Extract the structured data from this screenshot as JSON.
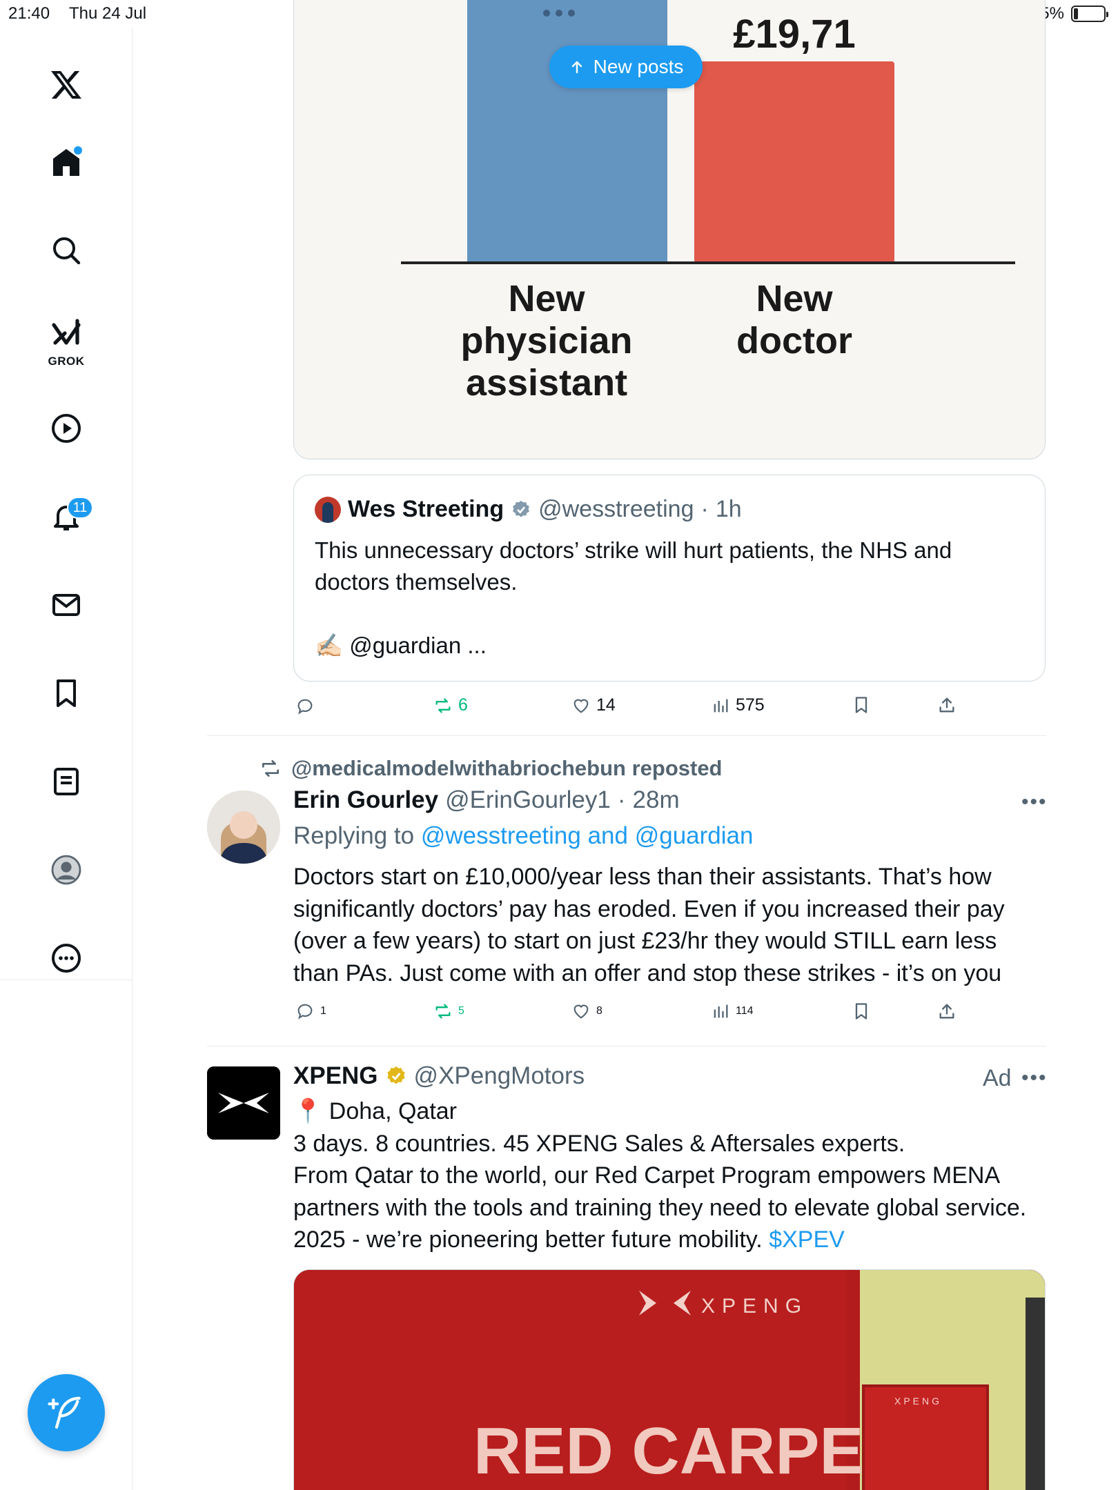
{
  "status_bar": {
    "time": "21:40",
    "date": "Thu 24 Jul",
    "battery": "15%"
  },
  "sidebar": {
    "grok_label": "GROK",
    "notifications_badge": "11"
  },
  "new_posts_label": "New posts",
  "chart_data": {
    "type": "bar",
    "categories": [
      "New physician assistant",
      "New doctor"
    ],
    "category_lines": [
      [
        "New",
        "physician",
        "assistant"
      ],
      [
        "New",
        "doctor"
      ]
    ],
    "visible_value_labels": [
      "",
      "£19,71"
    ],
    "colors": [
      "#6494c0",
      "#e0594a"
    ],
    "note_cropped": true
  },
  "quoted_post": {
    "name": "Wes Streeting",
    "handle": "@wesstreeting",
    "time": "1h",
    "text_line1": "This unnecessary doctors’ strike will hurt patients, the NHS and",
    "text_line2": "doctors themselves.",
    "text_line3": "✍🏻 @guardian ..."
  },
  "post1_actions": {
    "replies": "",
    "reposts": "6",
    "likes": "14",
    "views": "575"
  },
  "repost_banner": "@medicalmodelwithabriochebun reposted",
  "post2": {
    "name": "Erin Gourley",
    "handle": "@ErinGourley1",
    "time": "28m",
    "replying_prefix": "Replying to",
    "replying_targets": "@wesstreeting and @guardian",
    "lines": [
      "Doctors start on £10,000/year less than their assistants. That’s how",
      "significantly doctors’ pay has eroded. Even if you increased their pay",
      "(over a few years) to start on just £23/hr they would STILL earn less",
      "than PAs. Just come with an offer and stop these strikes - it’s on you"
    ],
    "actions": {
      "replies": "1",
      "reposts": "5",
      "likes": "8",
      "views": "114"
    }
  },
  "post3": {
    "name": "XPENG",
    "handle": "@XPengMotors",
    "ad_label": "Ad",
    "location": "Doha, Qatar",
    "lines": [
      "3 days. 8 countries. 45 XPENG Sales & Aftersales experts.",
      "From Qatar to the world, our Red Carpet Program empowers MENA",
      "partners with the tools and training they need to elevate global service."
    ],
    "last_line_text": "2025 - we’re pioneering better future mobility. ",
    "cashtag": "$XPEV",
    "image_brand": "XPENG",
    "image_headline": "RED CARPET",
    "image_small_brand": "XPENG"
  }
}
